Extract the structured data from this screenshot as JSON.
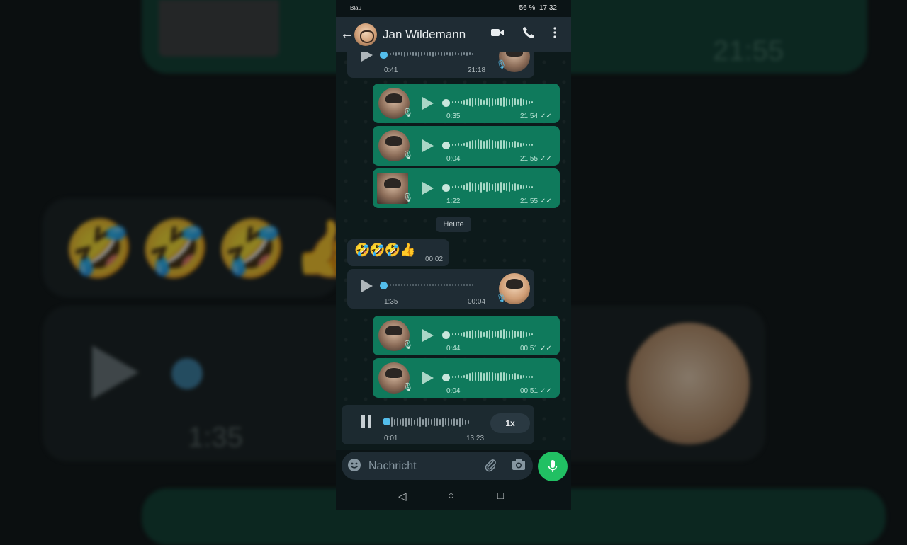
{
  "status_bar": {
    "carrier": "Blau",
    "battery": "56 %",
    "time": "17:32"
  },
  "header": {
    "contact_name": "Jan Wildemann"
  },
  "icons": {
    "back": "arrow-left-icon",
    "video": "video-call-icon",
    "call": "phone-icon",
    "menu": "more-vert-icon",
    "emoji": "emoji-icon",
    "attach": "paperclip-icon",
    "camera": "camera-icon",
    "mic": "mic-icon"
  },
  "colors": {
    "incoming_bubble": "#1f2c34",
    "outgoing_bubble": "#0f7a5c",
    "accent": "#21c063",
    "unplayed_dot": "#53bdeb"
  },
  "messages": [
    {
      "dir": "in",
      "duration": "0:41",
      "time": "21:18"
    },
    {
      "dir": "out",
      "duration": "0:35",
      "time": "21:54"
    },
    {
      "dir": "out",
      "duration": "0:04",
      "time": "21:55"
    },
    {
      "dir": "out",
      "duration": "1:22",
      "time": "21:55"
    },
    {
      "dir": "date",
      "label": "Heute"
    },
    {
      "dir": "in",
      "text": "🤣🤣🤣👍",
      "time": "00:02"
    },
    {
      "dir": "in",
      "duration": "1:35",
      "time": "00:04"
    },
    {
      "dir": "out",
      "duration": "0:44",
      "time": "00:51"
    },
    {
      "dir": "out",
      "duration": "0:04",
      "time": "00:51"
    }
  ],
  "player": {
    "position": "0:01",
    "total": "13:23",
    "speed": "1x",
    "progress": 0.02
  },
  "input": {
    "placeholder": "Nachricht"
  },
  "background": {
    "time_right": "21:55",
    "duration_left": "1:35"
  }
}
